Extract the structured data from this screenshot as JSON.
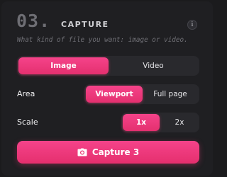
{
  "section": {
    "number": "03.",
    "title": "CAPTURE",
    "info_icon": "info-icon",
    "info_glyph": "i",
    "subtitle": "What kind of file you want: image or video."
  },
  "mode": {
    "options": [
      "Image",
      "Video"
    ],
    "selected": "Image"
  },
  "area": {
    "label": "Area",
    "options": [
      "Viewport",
      "Full page"
    ],
    "selected": "Viewport"
  },
  "scale": {
    "label": "Scale",
    "options": [
      "1x",
      "2x"
    ],
    "selected": "1x"
  },
  "capture_button": {
    "icon": "camera-icon",
    "label": "Capture 3"
  },
  "colors": {
    "accent": "#f0407f",
    "panel": "#1f1f22",
    "segment_bg": "#29292d",
    "muted_text": "#6f6f75"
  }
}
